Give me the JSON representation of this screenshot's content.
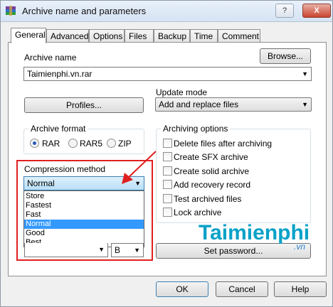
{
  "window": {
    "title": "Archive name and parameters"
  },
  "titlebar_buttons": {
    "help": "?",
    "close": "X"
  },
  "tabs": [
    {
      "label": "General"
    },
    {
      "label": "Advanced"
    },
    {
      "label": "Options"
    },
    {
      "label": "Files"
    },
    {
      "label": "Backup"
    },
    {
      "label": "Time"
    },
    {
      "label": "Comment"
    }
  ],
  "archive": {
    "name_label": "Archive name",
    "name_value": "Taimienphi.vn.rar",
    "browse_label": "Browse...",
    "profiles_label": "Profiles...",
    "update_mode_label": "Update mode",
    "update_mode_value": "Add and replace files"
  },
  "archive_format": {
    "title": "Archive format",
    "options": [
      {
        "label": "RAR",
        "checked": true
      },
      {
        "label": "RAR5",
        "checked": false
      },
      {
        "label": "ZIP",
        "checked": false
      }
    ]
  },
  "compression": {
    "label": "Compression method",
    "value": "Normal",
    "options": [
      "Store",
      "Fastest",
      "Fast",
      "Normal",
      "Good",
      "Best"
    ],
    "selected_index": 3
  },
  "split_unit": {
    "value": "B"
  },
  "archiving_options": {
    "title": "Archiving options",
    "items": [
      {
        "label": "Delete files after archiving"
      },
      {
        "label": "Create SFX archive"
      },
      {
        "label": "Create solid archive"
      },
      {
        "label": "Add recovery record"
      },
      {
        "label": "Test archived files"
      },
      {
        "label": "Lock archive"
      }
    ]
  },
  "set_password_label": "Set password...",
  "footer": {
    "ok": "OK",
    "cancel": "Cancel",
    "help": "Help"
  },
  "watermark": {
    "brand": "Taimienphi",
    "tld": ".vn"
  },
  "colors": {
    "highlight": "#e02020",
    "selection": "#3399ff",
    "watermark": "#0aa1c8"
  }
}
